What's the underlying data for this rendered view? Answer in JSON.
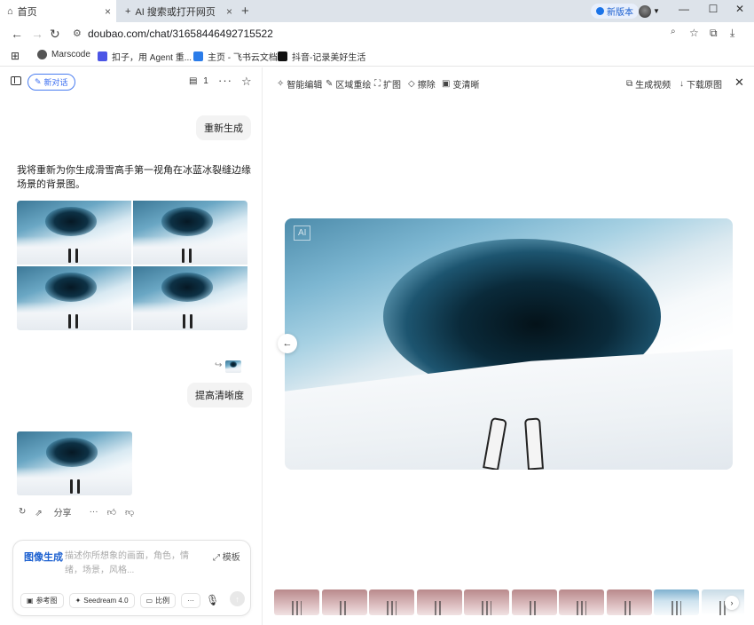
{
  "browser": {
    "tabs": [
      {
        "label": "首页",
        "active": true
      },
      {
        "label": "AI 搜索或打开网页",
        "active": false
      }
    ],
    "new_version_label": "新版本",
    "url": "doubao.com/chat/31658446492715522",
    "bookmarks": [
      "Marscode",
      "扣子，用 Agent 重...",
      "主页 - 飞书云文档",
      "抖音-记录美好生活"
    ]
  },
  "left": {
    "new_chat_label": "新对话",
    "doc_count": "1",
    "messages": {
      "user_regenerate": "重新生成",
      "ai_reply": "我将重新为你生成滑雪高手第一视角在冰蓝冰裂缝边缘场景的背景图。",
      "user_enhance": "提高清晰度"
    },
    "actions": {
      "share_label": "分享"
    },
    "composer": {
      "mode_label": "图像生成",
      "placeholder": "描述你所想象的画面，角色，情绪，场景，风格...",
      "template_label": "模板",
      "ref_image_label": "参考图",
      "model_label": "Seedream 4.0",
      "ratio_label": "比例"
    }
  },
  "right": {
    "tools": [
      "智能编辑",
      "区域重绘",
      "扩图",
      "擦除",
      "变清晰"
    ],
    "generate_video_label": "生成视频",
    "download_label": "下载原图",
    "filmstrip_count": 10
  },
  "colors": {
    "accent": "#3b6ef0",
    "tabbar": "#dde3ea"
  }
}
